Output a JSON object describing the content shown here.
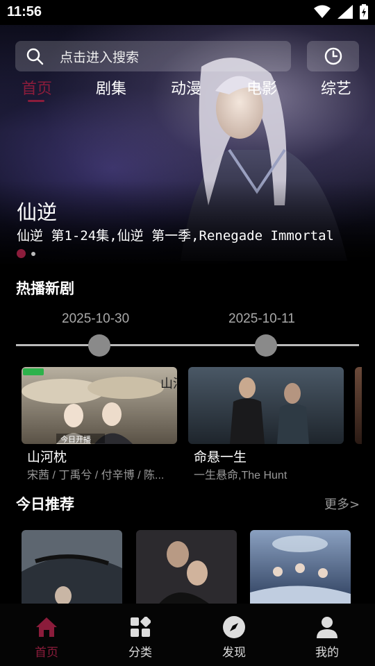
{
  "status": {
    "time": "11:56"
  },
  "search": {
    "placeholder": "点击进入搜索"
  },
  "tabs": [
    "首页",
    "剧集",
    "动漫",
    "电影",
    "综艺"
  ],
  "hero": {
    "title": "仙逆",
    "subtitle": "仙逆 第1-24集,仙逆 第一季,Renegade Immortal",
    "slides": 2,
    "active_slide": 1
  },
  "hot_new": {
    "title": "热播新剧",
    "dates": [
      "2025-10-30",
      "2025-10-11"
    ],
    "items": [
      {
        "title": "山河枕",
        "cast": "宋茜 / 丁禹兮 / 付辛博 / 陈...",
        "poster_text": "山河枕",
        "badge": "今日开播"
      },
      {
        "title": "命悬一生",
        "cast": "一生悬命,The Hunt"
      }
    ]
  },
  "today_rec": {
    "title": "今日推荐",
    "more": "更多>"
  },
  "nav": {
    "items": [
      {
        "label": "首页",
        "icon": "home-icon"
      },
      {
        "label": "分类",
        "icon": "category-icon"
      },
      {
        "label": "发现",
        "icon": "compass-icon"
      },
      {
        "label": "我的",
        "icon": "user-icon"
      }
    ],
    "active": 0
  },
  "colors": {
    "accent": "#8b1c3b",
    "background": "#000000"
  }
}
